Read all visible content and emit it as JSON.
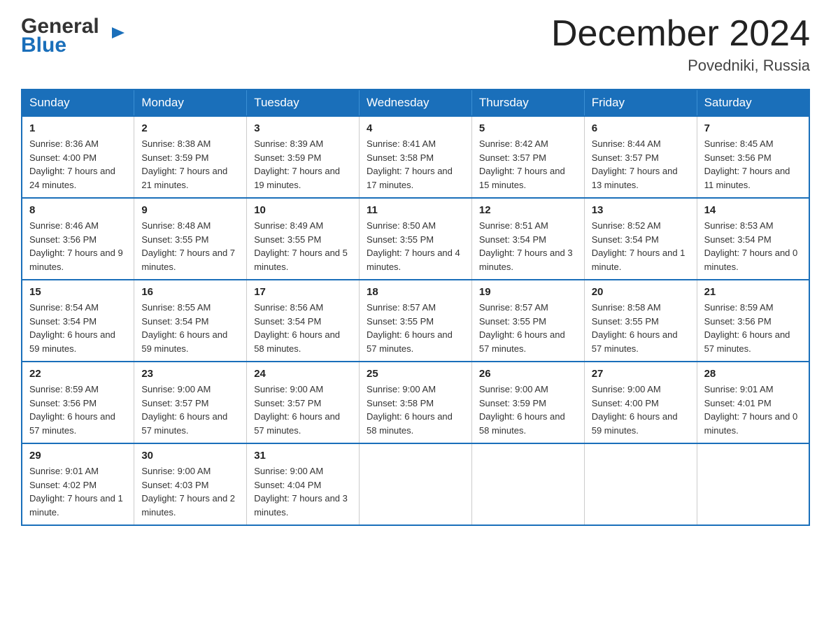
{
  "logo": {
    "general": "General",
    "triangle": "▶",
    "blue": "Blue"
  },
  "header": {
    "title": "December 2024",
    "subtitle": "Povedniki, Russia"
  },
  "days_of_week": [
    "Sunday",
    "Monday",
    "Tuesday",
    "Wednesday",
    "Thursday",
    "Friday",
    "Saturday"
  ],
  "weeks": [
    [
      {
        "day": "1",
        "sunrise": "Sunrise: 8:36 AM",
        "sunset": "Sunset: 4:00 PM",
        "daylight": "Daylight: 7 hours and 24 minutes."
      },
      {
        "day": "2",
        "sunrise": "Sunrise: 8:38 AM",
        "sunset": "Sunset: 3:59 PM",
        "daylight": "Daylight: 7 hours and 21 minutes."
      },
      {
        "day": "3",
        "sunrise": "Sunrise: 8:39 AM",
        "sunset": "Sunset: 3:59 PM",
        "daylight": "Daylight: 7 hours and 19 minutes."
      },
      {
        "day": "4",
        "sunrise": "Sunrise: 8:41 AM",
        "sunset": "Sunset: 3:58 PM",
        "daylight": "Daylight: 7 hours and 17 minutes."
      },
      {
        "day": "5",
        "sunrise": "Sunrise: 8:42 AM",
        "sunset": "Sunset: 3:57 PM",
        "daylight": "Daylight: 7 hours and 15 minutes."
      },
      {
        "day": "6",
        "sunrise": "Sunrise: 8:44 AM",
        "sunset": "Sunset: 3:57 PM",
        "daylight": "Daylight: 7 hours and 13 minutes."
      },
      {
        "day": "7",
        "sunrise": "Sunrise: 8:45 AM",
        "sunset": "Sunset: 3:56 PM",
        "daylight": "Daylight: 7 hours and 11 minutes."
      }
    ],
    [
      {
        "day": "8",
        "sunrise": "Sunrise: 8:46 AM",
        "sunset": "Sunset: 3:56 PM",
        "daylight": "Daylight: 7 hours and 9 minutes."
      },
      {
        "day": "9",
        "sunrise": "Sunrise: 8:48 AM",
        "sunset": "Sunset: 3:55 PM",
        "daylight": "Daylight: 7 hours and 7 minutes."
      },
      {
        "day": "10",
        "sunrise": "Sunrise: 8:49 AM",
        "sunset": "Sunset: 3:55 PM",
        "daylight": "Daylight: 7 hours and 5 minutes."
      },
      {
        "day": "11",
        "sunrise": "Sunrise: 8:50 AM",
        "sunset": "Sunset: 3:55 PM",
        "daylight": "Daylight: 7 hours and 4 minutes."
      },
      {
        "day": "12",
        "sunrise": "Sunrise: 8:51 AM",
        "sunset": "Sunset: 3:54 PM",
        "daylight": "Daylight: 7 hours and 3 minutes."
      },
      {
        "day": "13",
        "sunrise": "Sunrise: 8:52 AM",
        "sunset": "Sunset: 3:54 PM",
        "daylight": "Daylight: 7 hours and 1 minute."
      },
      {
        "day": "14",
        "sunrise": "Sunrise: 8:53 AM",
        "sunset": "Sunset: 3:54 PM",
        "daylight": "Daylight: 7 hours and 0 minutes."
      }
    ],
    [
      {
        "day": "15",
        "sunrise": "Sunrise: 8:54 AM",
        "sunset": "Sunset: 3:54 PM",
        "daylight": "Daylight: 6 hours and 59 minutes."
      },
      {
        "day": "16",
        "sunrise": "Sunrise: 8:55 AM",
        "sunset": "Sunset: 3:54 PM",
        "daylight": "Daylight: 6 hours and 59 minutes."
      },
      {
        "day": "17",
        "sunrise": "Sunrise: 8:56 AM",
        "sunset": "Sunset: 3:54 PM",
        "daylight": "Daylight: 6 hours and 58 minutes."
      },
      {
        "day": "18",
        "sunrise": "Sunrise: 8:57 AM",
        "sunset": "Sunset: 3:55 PM",
        "daylight": "Daylight: 6 hours and 57 minutes."
      },
      {
        "day": "19",
        "sunrise": "Sunrise: 8:57 AM",
        "sunset": "Sunset: 3:55 PM",
        "daylight": "Daylight: 6 hours and 57 minutes."
      },
      {
        "day": "20",
        "sunrise": "Sunrise: 8:58 AM",
        "sunset": "Sunset: 3:55 PM",
        "daylight": "Daylight: 6 hours and 57 minutes."
      },
      {
        "day": "21",
        "sunrise": "Sunrise: 8:59 AM",
        "sunset": "Sunset: 3:56 PM",
        "daylight": "Daylight: 6 hours and 57 minutes."
      }
    ],
    [
      {
        "day": "22",
        "sunrise": "Sunrise: 8:59 AM",
        "sunset": "Sunset: 3:56 PM",
        "daylight": "Daylight: 6 hours and 57 minutes."
      },
      {
        "day": "23",
        "sunrise": "Sunrise: 9:00 AM",
        "sunset": "Sunset: 3:57 PM",
        "daylight": "Daylight: 6 hours and 57 minutes."
      },
      {
        "day": "24",
        "sunrise": "Sunrise: 9:00 AM",
        "sunset": "Sunset: 3:57 PM",
        "daylight": "Daylight: 6 hours and 57 minutes."
      },
      {
        "day": "25",
        "sunrise": "Sunrise: 9:00 AM",
        "sunset": "Sunset: 3:58 PM",
        "daylight": "Daylight: 6 hours and 58 minutes."
      },
      {
        "day": "26",
        "sunrise": "Sunrise: 9:00 AM",
        "sunset": "Sunset: 3:59 PM",
        "daylight": "Daylight: 6 hours and 58 minutes."
      },
      {
        "day": "27",
        "sunrise": "Sunrise: 9:00 AM",
        "sunset": "Sunset: 4:00 PM",
        "daylight": "Daylight: 6 hours and 59 minutes."
      },
      {
        "day": "28",
        "sunrise": "Sunrise: 9:01 AM",
        "sunset": "Sunset: 4:01 PM",
        "daylight": "Daylight: 7 hours and 0 minutes."
      }
    ],
    [
      {
        "day": "29",
        "sunrise": "Sunrise: 9:01 AM",
        "sunset": "Sunset: 4:02 PM",
        "daylight": "Daylight: 7 hours and 1 minute."
      },
      {
        "day": "30",
        "sunrise": "Sunrise: 9:00 AM",
        "sunset": "Sunset: 4:03 PM",
        "daylight": "Daylight: 7 hours and 2 minutes."
      },
      {
        "day": "31",
        "sunrise": "Sunrise: 9:00 AM",
        "sunset": "Sunset: 4:04 PM",
        "daylight": "Daylight: 7 hours and 3 minutes."
      },
      {
        "day": "",
        "sunrise": "",
        "sunset": "",
        "daylight": ""
      },
      {
        "day": "",
        "sunrise": "",
        "sunset": "",
        "daylight": ""
      },
      {
        "day": "",
        "sunrise": "",
        "sunset": "",
        "daylight": ""
      },
      {
        "day": "",
        "sunrise": "",
        "sunset": "",
        "daylight": ""
      }
    ]
  ]
}
